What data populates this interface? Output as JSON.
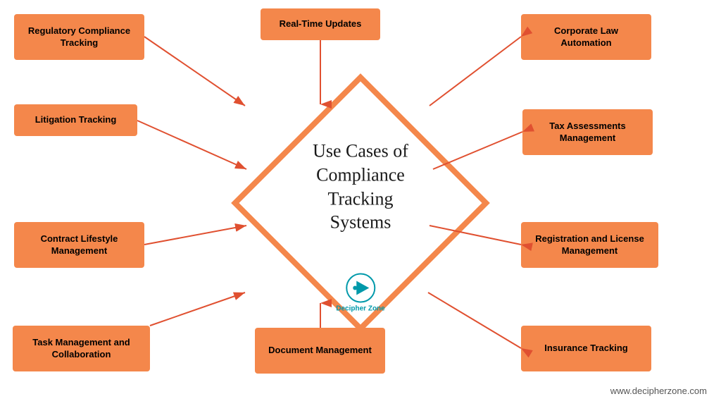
{
  "title": "Use Cases of Compliance Tracking Systems",
  "subtitle_line1": "Use Cases of",
  "subtitle_line2": "Compliance",
  "subtitle_line3": "Tracking",
  "subtitle_line4": "Systems",
  "logo_text": "Decipher Zone",
  "website": "www.decipherzone.com",
  "boxes": [
    {
      "id": "regulatory",
      "label": "Regulatory Compliance Tracking"
    },
    {
      "id": "real-time",
      "label": "Real-Time Updates"
    },
    {
      "id": "corporate",
      "label": "Corporate Law Automation"
    },
    {
      "id": "litigation",
      "label": "Litigation Tracking"
    },
    {
      "id": "tax",
      "label": "Tax Assessments Management"
    },
    {
      "id": "contract",
      "label": "Contract Lifestyle Management"
    },
    {
      "id": "registration",
      "label": "Registration and License Management"
    },
    {
      "id": "task",
      "label": "Task Management and Collaboration"
    },
    {
      "id": "document",
      "label": "Document Management"
    },
    {
      "id": "insurance",
      "label": "Insurance Tracking"
    }
  ],
  "colors": {
    "box_bg": "#f4874b",
    "arrow": "#e05030",
    "center_border": "#f4874b",
    "logo_color": "#0099aa"
  }
}
